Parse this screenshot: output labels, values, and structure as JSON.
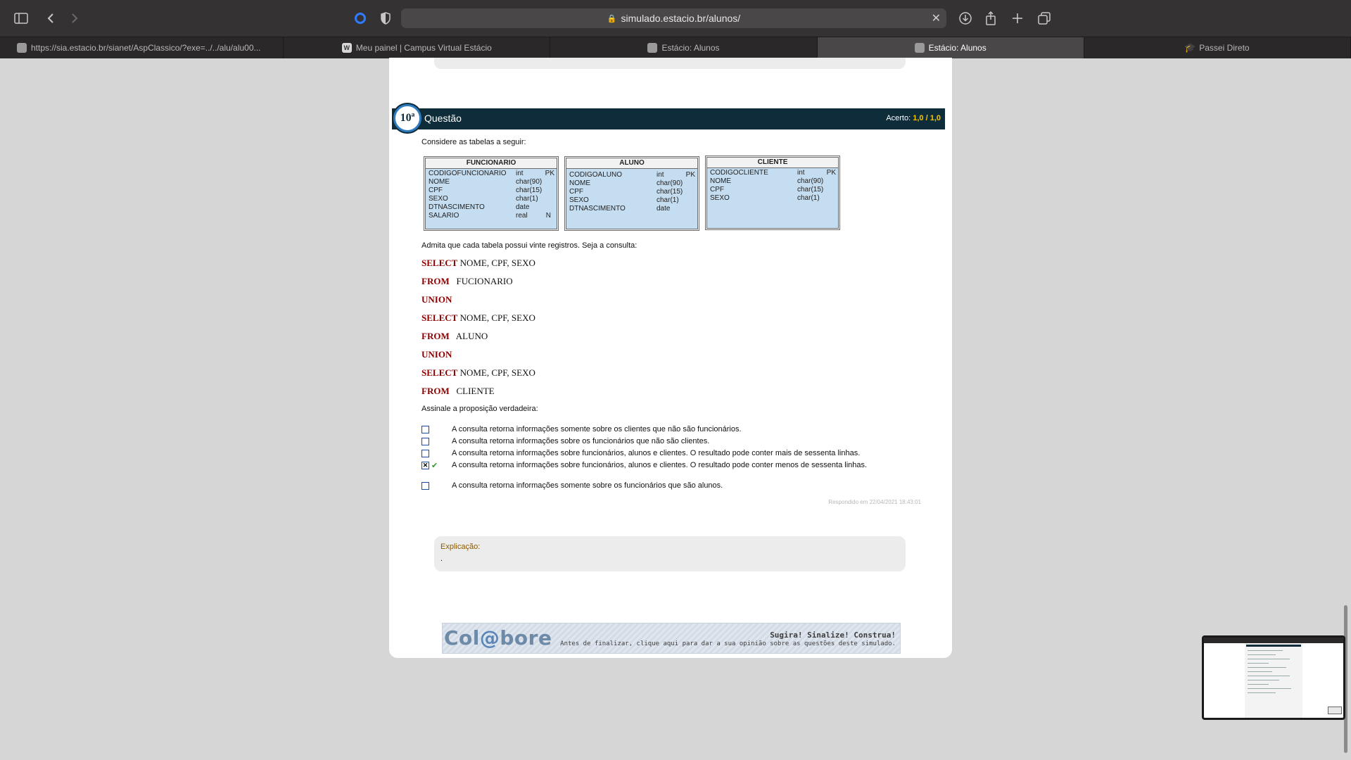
{
  "browser": {
    "url": "simulado.estacio.br/alunos/",
    "tabs": [
      {
        "label": "https://sia.estacio.br/sianet/AspClassico/?exe=../../alu/alu00...",
        "icon": "page-icon",
        "active": false
      },
      {
        "label": "Meu painel | Campus Virtual Estácio",
        "icon": "w-favicon",
        "active": false
      },
      {
        "label": "Estácio: Alunos",
        "icon": "estacio-favicon",
        "active": false
      },
      {
        "label": "Estácio: Alunos",
        "icon": "estacio-favicon",
        "active": true
      },
      {
        "label": "Passei Direto",
        "icon": "graduation-cap-icon",
        "active": false
      }
    ]
  },
  "question": {
    "number": "10ª",
    "title": "Questão",
    "score_label": "Acerto:",
    "score_value": "1,0",
    "score_max": "/ 1,0",
    "intro": "Considere as tabelas a seguir:",
    "tables": [
      {
        "name": "FUNCIONARIO",
        "rows": [
          [
            "CODIGOFUNCIONARIO",
            "int",
            "PK"
          ],
          [
            "NOME",
            "char(90)",
            ""
          ],
          [
            "CPF",
            "char(15)",
            ""
          ],
          [
            "SEXO",
            "char(1)",
            ""
          ],
          [
            "DTNASCIMENTO",
            "date",
            ""
          ],
          [
            "SALARIO",
            "real",
            "N"
          ]
        ]
      },
      {
        "name": "ALUNO",
        "rows": [
          [
            "CODIGOALUNO",
            "int",
            "PK"
          ],
          [
            "NOME",
            "char(90)",
            ""
          ],
          [
            "CPF",
            "char(15)",
            ""
          ],
          [
            "SEXO",
            "char(1)",
            ""
          ],
          [
            "DTNASCIMENTO",
            "date",
            ""
          ]
        ]
      },
      {
        "name": "CLIENTE",
        "rows": [
          [
            "CODIGOCLIENTE",
            "int",
            "PK"
          ],
          [
            "NOME",
            "char(90)",
            ""
          ],
          [
            "CPF",
            "char(15)",
            ""
          ],
          [
            "SEXO",
            "char(1)",
            ""
          ]
        ]
      }
    ],
    "assumption": "Admita que cada tabela possui vinte registros. Seja a consulta:",
    "sql": [
      {
        "kw": "SELECT",
        "rest": "NOME, CPF, SEXO"
      },
      {
        "kw": "FROM",
        "rest": "FUCIONARIO"
      },
      {
        "kw": "UNION",
        "rest": ""
      },
      {
        "kw": "SELECT",
        "rest": "NOME, CPF, SEXO"
      },
      {
        "kw": "FROM",
        "rest": "ALUNO"
      },
      {
        "kw": "UNION",
        "rest": ""
      },
      {
        "kw": "SELECT",
        "rest": "NOME, CPF, SEXO"
      },
      {
        "kw": "FROM",
        "rest": "CLIENTE"
      }
    ],
    "prompt": "Assinale a proposição verdadeira:",
    "options": [
      {
        "text": "A consulta retorna informações somente sobre os clientes que não são funcionários.",
        "checked": false,
        "correct": false
      },
      {
        "text": "A consulta retorna informações sobre os funcionários que não são clientes.",
        "checked": false,
        "correct": false
      },
      {
        "text": "A consulta retorna informações sobre funcionários, alunos e clientes. O resultado pode conter mais de sessenta linhas.",
        "checked": false,
        "correct": false
      },
      {
        "text": "A consulta retorna informações sobre funcionários, alunos e clientes. O resultado pode conter menos de sessenta linhas.",
        "checked": true,
        "correct": true
      },
      {
        "text": "A consulta retorna informações somente sobre os funcionários que são alunos.",
        "checked": false,
        "correct": false
      }
    ],
    "answered_at": "Respondido em 22/04/2021 18:43:01"
  },
  "explanation": {
    "label": "Explicação:",
    "text": "."
  },
  "banner": {
    "logo_a": "Col",
    "logo_at": "@",
    "logo_b": "bore",
    "headline": "Sugira! Sinalize! Construa!",
    "subtext": "Antes de finalizar, clique aqui para dar a sua opinião sobre as questões deste simulado."
  },
  "colors": {
    "header_bg": "#0e2c3a",
    "score": "#f5c400",
    "sql_keyword": "#8b0000",
    "table_bg": "#c5ddf0",
    "check": "#2a9a2a"
  }
}
